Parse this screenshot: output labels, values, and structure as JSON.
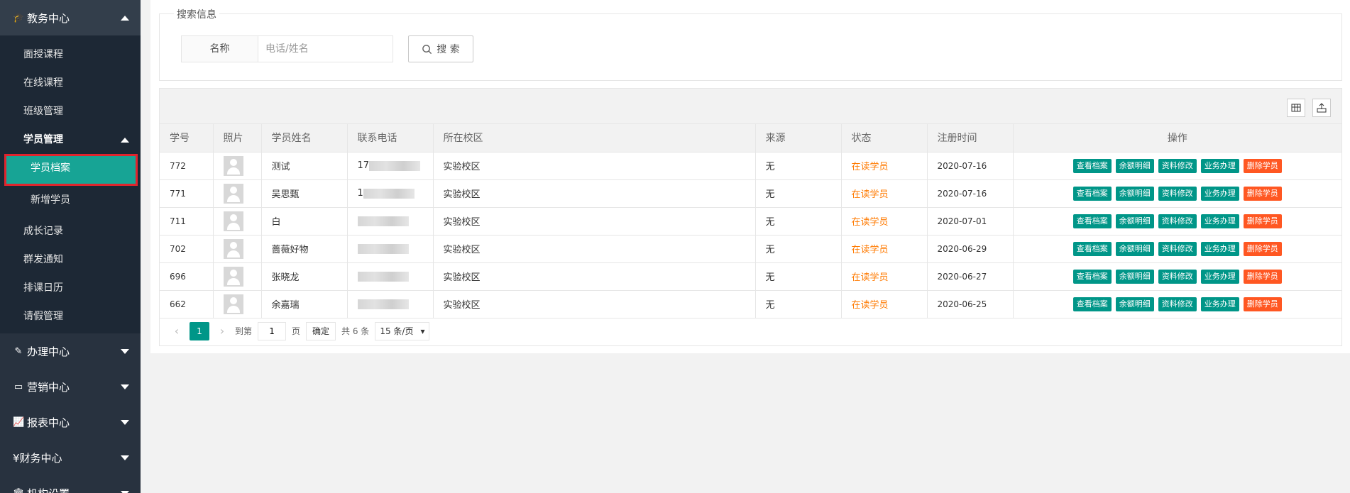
{
  "sidebar": {
    "sections": {
      "academic": {
        "label": "教务中心",
        "icon": "graduation-cap-icon"
      },
      "affairs": {
        "label": "办理中心",
        "icon": "edit-icon"
      },
      "marketing": {
        "label": "营销中心",
        "icon": "laptop-icon"
      },
      "reports": {
        "label": "报表中心",
        "icon": "chart-icon"
      },
      "finance": {
        "label": "¥财务中心",
        "icon": "yen-icon"
      },
      "org": {
        "label": "机构设置",
        "icon": "bank-icon"
      }
    },
    "items": {
      "face_course": "面授课程",
      "online_course": "在线课程",
      "class_mgmt": "班级管理",
      "student_mgmt": "学员管理",
      "student_files": "学员档案",
      "add_student": "新增学员",
      "growth": "成长记录",
      "notice": "群发通知",
      "calendar": "排课日历",
      "leave": "请假管理"
    }
  },
  "search": {
    "legend": "搜索信息",
    "label": "名称",
    "placeholder": "电话/姓名",
    "button": "搜 索"
  },
  "table": {
    "columns": [
      "学号",
      "照片",
      "学员姓名",
      "联系电话",
      "所在校区",
      "来源",
      "状态",
      "注册时间",
      "操作"
    ],
    "rows": [
      {
        "id": "772",
        "name": "测试",
        "phone_prefix": "17",
        "campus": "实验校区",
        "source": "无",
        "status": "在读学员",
        "date": "2020-07-16"
      },
      {
        "id": "771",
        "name": "吴思甄",
        "phone_prefix": "1",
        "campus": "实验校区",
        "source": "无",
        "status": "在读学员",
        "date": "2020-07-16"
      },
      {
        "id": "711",
        "name": "白",
        "phone_prefix": "",
        "campus": "实验校区",
        "source": "无",
        "status": "在读学员",
        "date": "2020-07-01"
      },
      {
        "id": "702",
        "name": "蔷薇好物",
        "phone_prefix": "",
        "campus": "实验校区",
        "source": "无",
        "status": "在读学员",
        "date": "2020-06-29"
      },
      {
        "id": "696",
        "name": "张晓龙",
        "phone_prefix": "",
        "campus": "实验校区",
        "source": "无",
        "status": "在读学员",
        "date": "2020-06-27"
      },
      {
        "id": "662",
        "name": "余嘉瑞",
        "phone_prefix": "",
        "campus": "实验校区",
        "source": "无",
        "status": "在读学员",
        "date": "2020-06-25"
      }
    ],
    "actions": {
      "view": "查看档案",
      "balance": "余额明细",
      "edit": "资料修改",
      "business": "业务办理",
      "delete": "删除学员"
    }
  },
  "pager": {
    "prev": "‹",
    "current": "1",
    "next": "›",
    "goto_label": "到第",
    "goto_value": "1",
    "page_unit": "页",
    "confirm": "确定",
    "total": "共 6 条",
    "per_page": "15 条/页"
  },
  "colors": {
    "sidebar_bg": "#28323f",
    "accent": "#009688",
    "danger": "#ff5722",
    "status": "#ff7a00"
  }
}
